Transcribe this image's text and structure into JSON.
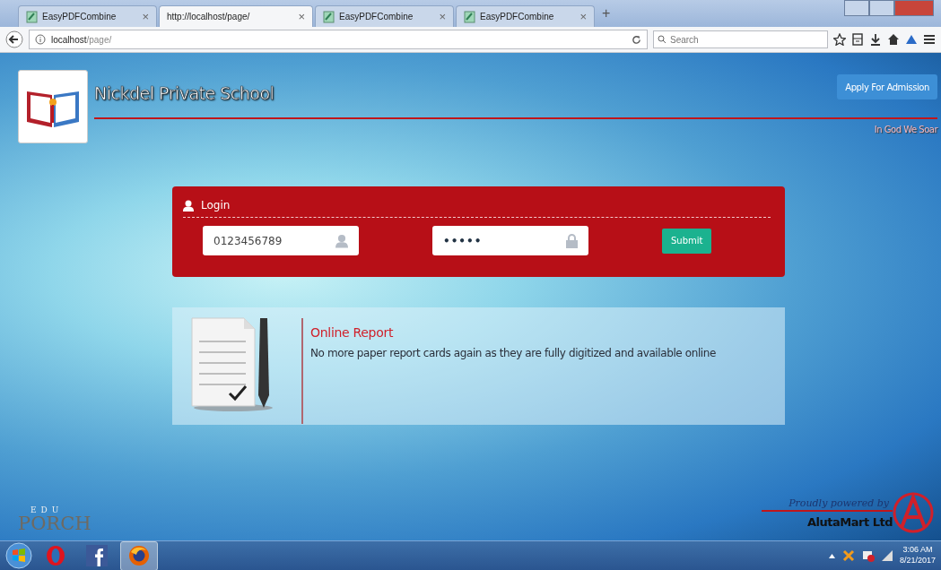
{
  "browser": {
    "tabs": [
      {
        "title": "EasyPDFCombine",
        "selected": false
      },
      {
        "title": "http://localhost/page/",
        "selected": true
      },
      {
        "title": "EasyPDFCombine",
        "selected": false
      },
      {
        "title": "EasyPDFCombine",
        "selected": false
      }
    ],
    "new_tab": "+",
    "close": "×",
    "address": {
      "host": "localhost",
      "path": "/page/"
    },
    "search": {
      "placeholder": "Search"
    }
  },
  "page": {
    "school_name": "Nickdel Private School",
    "apply_button": "Apply For Admission",
    "motto": "In God We Soar",
    "login": {
      "title": "Login",
      "username": "0123456789",
      "password": "•••••",
      "submit": "Submit"
    },
    "feature": {
      "title": "Online Report",
      "text": "No more paper report cards again as they are fully digitized and available online"
    },
    "footer_left": {
      "top": "EDU",
      "bottom": "PORCH"
    },
    "footer_right": {
      "tagline": "Proudly powered by",
      "company": "AlutaMart Ltd"
    }
  },
  "taskbar": {
    "apps": [
      {
        "kind": "opera",
        "selected": false
      },
      {
        "kind": "facebook",
        "selected": false
      },
      {
        "kind": "firefox",
        "selected": true
      }
    ],
    "time": "3:06 AM",
    "date": "8/21/2017"
  }
}
